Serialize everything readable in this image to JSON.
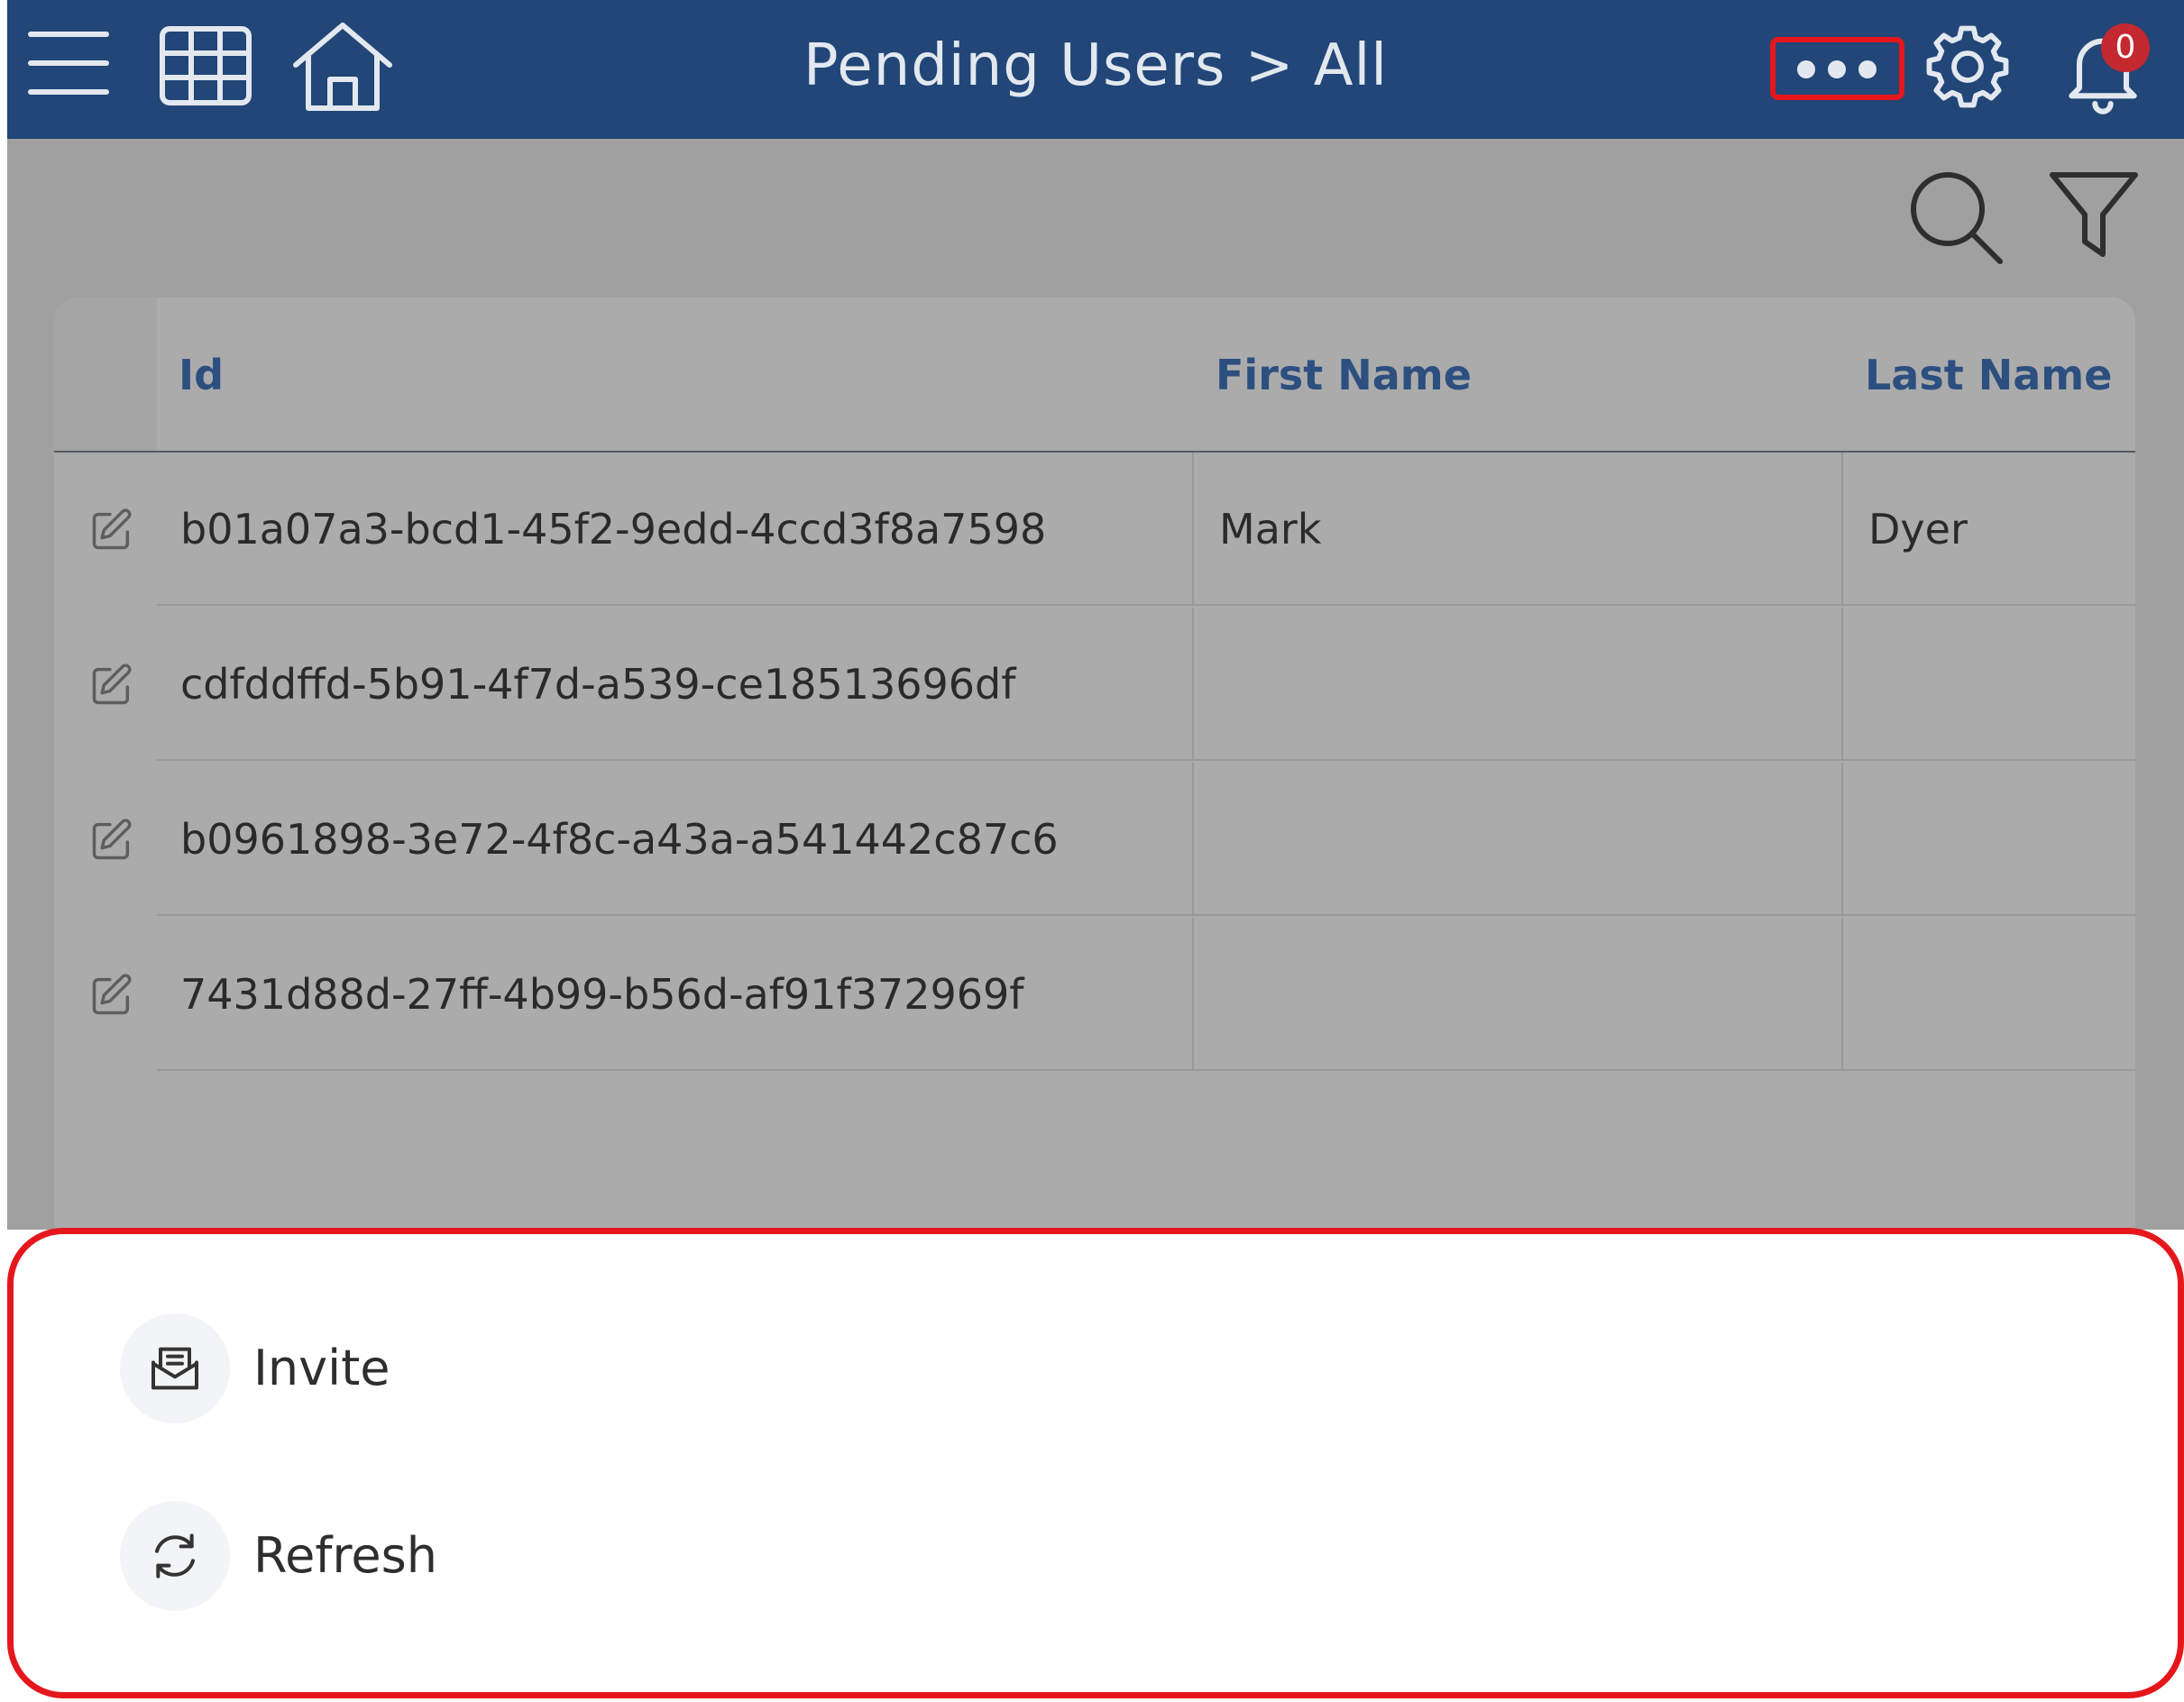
{
  "header": {
    "title": "Pending Users > All",
    "notification_count": "0",
    "icons": [
      "menu-icon",
      "grid-icon",
      "home-icon",
      "more-icon",
      "gear-icon",
      "bell-icon"
    ]
  },
  "toolbar": {
    "icons": [
      "search-icon",
      "filter-icon"
    ]
  },
  "table": {
    "columns": [
      "Id",
      "First Name",
      "Last Name"
    ],
    "rows": [
      {
        "id": "b01a07a3-bcd1-45f2-9edd-4ccd3f8a7598",
        "first_name": "Mark",
        "last_name": "Dyer"
      },
      {
        "id": "cdfddffd-5b91-4f7d-a539-ce18513696df",
        "first_name": "",
        "last_name": ""
      },
      {
        "id": "b0961898-3e72-4f8c-a43a-a541442c87c6",
        "first_name": "",
        "last_name": ""
      },
      {
        "id": "7431d88d-27ff-4b99-b56d-af91f372969f",
        "first_name": "",
        "last_name": ""
      }
    ]
  },
  "sheet": {
    "actions": [
      {
        "label": "Invite",
        "icon": "invite-mail-icon"
      },
      {
        "label": "Refresh",
        "icon": "refresh-icon"
      }
    ]
  },
  "colors": {
    "header_bg": "#214677",
    "highlight": "#e5171d",
    "badge": "#c4292f",
    "column_header": "#2c4f80"
  }
}
